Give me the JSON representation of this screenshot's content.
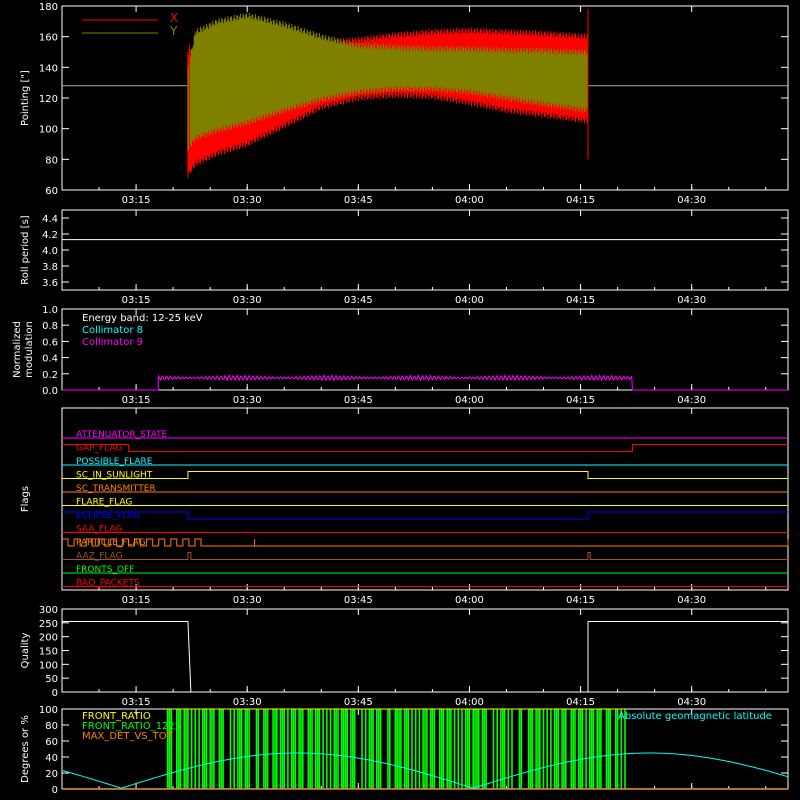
{
  "colors": {
    "background": "#000000",
    "axes": "#ffffff",
    "x_series": "#ff0000",
    "y_series": "#808000",
    "cyan": "#00ffff",
    "magenta": "#ff00ff",
    "green": "#00ff00",
    "orange": "#ff8000",
    "yellow": "#ffff00",
    "blue": "#0000ff",
    "red": "#ff0000",
    "brown": "#a0522d"
  },
  "time_axis": {
    "start": "03:05",
    "end": "04:43",
    "tick_labels": [
      "03:15",
      "03:30",
      "03:45",
      "04:00",
      "04:15",
      "04:30"
    ],
    "tick_minutes": [
      195,
      210,
      225,
      240,
      255,
      270
    ]
  },
  "chart_data": [
    {
      "type": "line",
      "name": "pointing",
      "ylabel": "Pointing [\"]",
      "ylim": [
        60,
        180
      ],
      "y_ticks": [
        "60",
        "80",
        "100",
        "120",
        "140",
        "160",
        "180"
      ],
      "y_tick_values": [
        60,
        80,
        100,
        120,
        140,
        160,
        180
      ],
      "legend": "top-left",
      "reference_line": 128,
      "series": [
        {
          "name": "X",
          "color": "#ff0000",
          "x_minutes": [
            202,
            203,
            206,
            210,
            215,
            220,
            225,
            230,
            235,
            240,
            245,
            250,
            253,
            256
          ],
          "upper": [
            150,
            155,
            158,
            162,
            160,
            158,
            160,
            163,
            165,
            166,
            165,
            164,
            163,
            162
          ],
          "lower": [
            68,
            75,
            82,
            88,
            100,
            112,
            118,
            120,
            119,
            115,
            110,
            107,
            105,
            103
          ]
        },
        {
          "name": "Y",
          "color": "#808000",
          "x_minutes": [
            202,
            203,
            206,
            210,
            215,
            220,
            225,
            230,
            235,
            240,
            245,
            250,
            253,
            256
          ],
          "upper": [
            140,
            165,
            172,
            176,
            170,
            162,
            156,
            155,
            154,
            154,
            153,
            153,
            152,
            152
          ],
          "lower": [
            85,
            92,
            97,
            102,
            110,
            117,
            122,
            124,
            124,
            122,
            118,
            114,
            112,
            110
          ]
        }
      ]
    },
    {
      "type": "line",
      "name": "roll-period",
      "ylabel": "Roll period [s]",
      "ylim": [
        3.5,
        4.5
      ],
      "y_ticks": [
        "3.6",
        "3.8",
        "4.0",
        "4.2",
        "4.4"
      ],
      "y_tick_values": [
        3.6,
        3.8,
        4.0,
        4.2,
        4.4
      ],
      "constant": 4.13
    },
    {
      "type": "line",
      "name": "modulation",
      "ylabel": "Normalized modulation",
      "ylim": [
        0,
        1
      ],
      "y_ticks": [
        "0.0",
        "0.2",
        "0.4",
        "0.6",
        "0.8",
        "1.0"
      ],
      "y_tick_values": [
        0,
        0.2,
        0.4,
        0.6,
        0.8,
        1.0
      ],
      "legend_lines": [
        {
          "text": "Energy band: 12-25 keV",
          "color": "#ffffff"
        },
        {
          "text": "Collimator 8",
          "color": "#00ffff"
        },
        {
          "text": "Collimator 9",
          "color": "#ff00ff"
        }
      ],
      "series": [
        {
          "name": "Collimator 9",
          "color": "#ff00ff",
          "x_start": 198,
          "x_end": 262,
          "level": 0.15,
          "baseline": 0.0
        }
      ]
    },
    {
      "type": "line",
      "name": "flags",
      "ylabel": "Flags",
      "flags": [
        {
          "label": "ATTENUATOR_STATE",
          "color": "#ff00ff"
        },
        {
          "label": "GAP_FLAG",
          "color": "#ff0000"
        },
        {
          "label": "POSSIBLE_FLARE",
          "color": "#00ffff"
        },
        {
          "label": "SC_IN_SUNLIGHT",
          "color": "#ffff00"
        },
        {
          "label": "SC_TRANSMITTER",
          "color": "#ff8000"
        },
        {
          "label": "FLARE_FLAG",
          "color": "#ffff00"
        },
        {
          "label": "ECLIPSE_FLAG",
          "color": "#0000ff"
        },
        {
          "label": "SAA_FLAG",
          "color": "#ff0000"
        },
        {
          "label": "PARTICLE_FLAG",
          "color": "#ff8000"
        },
        {
          "label": "AAZ_FLAG",
          "color": "#a0522d"
        },
        {
          "label": "FRONTS_OFF",
          "color": "#00ff00"
        },
        {
          "label": "BAD_PACKETS",
          "color": "#ff0000"
        }
      ]
    },
    {
      "type": "line",
      "name": "quality",
      "ylabel": "Quality",
      "ylim": [
        0,
        300
      ],
      "y_ticks": [
        "0",
        "50",
        "100",
        "150",
        "200",
        "250",
        "300"
      ],
      "y_tick_values": [
        0,
        50,
        100,
        150,
        200,
        250,
        300
      ],
      "segments": [
        {
          "x_start": 185,
          "x_end": 202,
          "value": 255
        },
        {
          "x_start": 256,
          "x_end": 283,
          "value": 255
        }
      ]
    },
    {
      "type": "line",
      "name": "ratios",
      "ylabel": "Degrees or %",
      "ylim": [
        0,
        100
      ],
      "y_ticks": [
        "0",
        "20",
        "40",
        "60",
        "80",
        "100"
      ],
      "y_tick_values": [
        0,
        20,
        40,
        60,
        80,
        100
      ],
      "legend_left": [
        {
          "text": "FRONT_RATIO",
          "color": "#ffff00"
        },
        {
          "text": "FRONT_RATIO_1225",
          "color": "#00ff00"
        },
        {
          "text": "MAX_DET_VS_TOT",
          "color": "#ff8000"
        }
      ],
      "legend_right": {
        "text": "Absolute geomagnetic latitude",
        "color": "#00ffff"
      },
      "green_band": [
        199,
        261
      ]
    }
  ]
}
